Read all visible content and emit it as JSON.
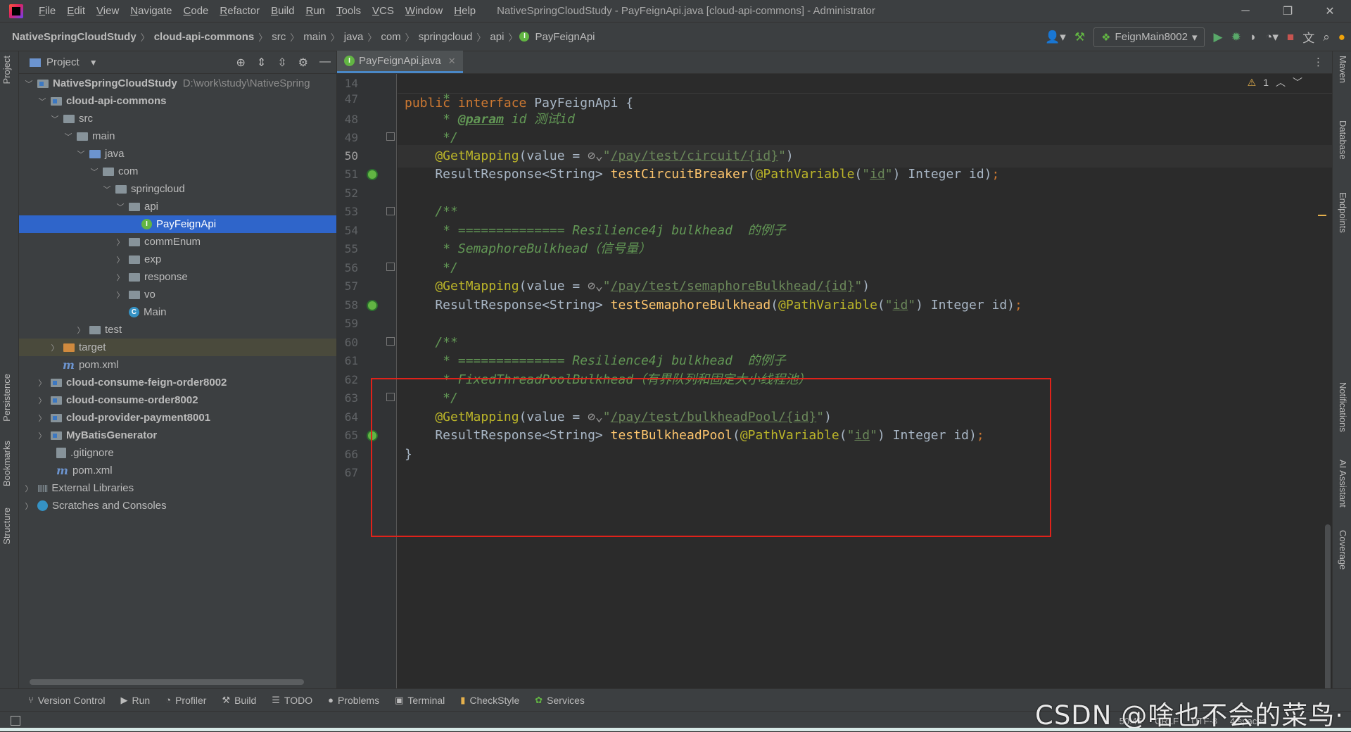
{
  "menubar": {
    "items": [
      "File",
      "Edit",
      "View",
      "Navigate",
      "Code",
      "Refactor",
      "Build",
      "Run",
      "Tools",
      "VCS",
      "Window",
      "Help"
    ],
    "title": "NativeSpringCloudStudy - PayFeignApi.java [cloud-api-commons] - Administrator"
  },
  "navbar": {
    "crumbs": [
      "NativeSpringCloudStudy",
      "cloud-api-commons",
      "src",
      "main",
      "java",
      "com",
      "springcloud",
      "api",
      "PayFeignApi"
    ],
    "run_config": "FeignMain8002"
  },
  "project_panel": {
    "title": "Project",
    "tree": [
      {
        "label": "NativeSpringCloudStudy",
        "hint": "D:\\work\\study\\NativeSpring",
        "bold": true
      },
      {
        "label": "cloud-api-commons",
        "bold": true
      },
      {
        "label": "src"
      },
      {
        "label": "main"
      },
      {
        "label": "java"
      },
      {
        "label": "com"
      },
      {
        "label": "springcloud"
      },
      {
        "label": "api"
      },
      {
        "label": "PayFeignApi"
      },
      {
        "label": "commEnum"
      },
      {
        "label": "exp"
      },
      {
        "label": "response"
      },
      {
        "label": "vo"
      },
      {
        "label": "Main"
      },
      {
        "label": "test"
      },
      {
        "label": "target"
      },
      {
        "label": "pom.xml"
      },
      {
        "label": "cloud-consume-feign-order8002",
        "bold": true
      },
      {
        "label": "cloud-consume-order8002",
        "bold": true
      },
      {
        "label": "cloud-provider-payment8001",
        "bold": true
      },
      {
        "label": "MyBatisGenerator",
        "bold": true
      },
      {
        "label": ".gitignore"
      },
      {
        "label": "pom.xml"
      },
      {
        "label": "External Libraries"
      },
      {
        "label": "Scratches and Consoles"
      }
    ]
  },
  "left_tabs": [
    "Project",
    "Persistence",
    "Bookmarks",
    "Structure"
  ],
  "right_tabs": [
    "Maven",
    "Database",
    "Endpoints",
    "Notifications",
    "AI Assistant",
    "Coverage"
  ],
  "editor": {
    "tab": "PayFeignApi.java",
    "sticky_line_number": "14",
    "sticky_line_text": "public interface PayFeignApi {",
    "inspection_count": "1",
    "line_numbers": [
      "47",
      "48",
      "49",
      "50",
      "51",
      "52",
      "53",
      "54",
      "55",
      "56",
      "57",
      "58",
      "59",
      "60",
      "61",
      "62",
      "63",
      "64",
      "65",
      "66",
      "67"
    ],
    "current_line": "50",
    "code": {
      "l48_tag": "@param",
      "l48_rest": " id 测试id",
      "l50_url": "/pay/test/circuit/{id}",
      "l51_method": "testCircuitBreaker",
      "l54_text": " * ============== Resilience4j bulkhead  的例子",
      "l55_text": " * SemaphoreBulkhead（信号量）",
      "l57_url": "/pay/test/semaphoreBulkhead/{id}",
      "l58_method": "testSemaphoreBulkhead",
      "l61_text": " * ============== Resilience4j bulkhead  的例子",
      "l62_text": " * FixedThreadPoolBulkhead（有界队列和固定大小线程池）",
      "l64_url": "/pay/test/bulkheadPool/{id}",
      "l65_method": "testBulkheadPool"
    }
  },
  "tool_windows": [
    "Version Control",
    "Run",
    "Profiler",
    "Build",
    "TODO",
    "Problems",
    "Terminal",
    "CheckStyle",
    "Services"
  ],
  "status": {
    "position": "50:46",
    "line_sep": "CRLF",
    "encoding": "UTF-8",
    "indent": "4 spaces"
  },
  "watermark": "CSDN @啥也不会的菜鸟·"
}
